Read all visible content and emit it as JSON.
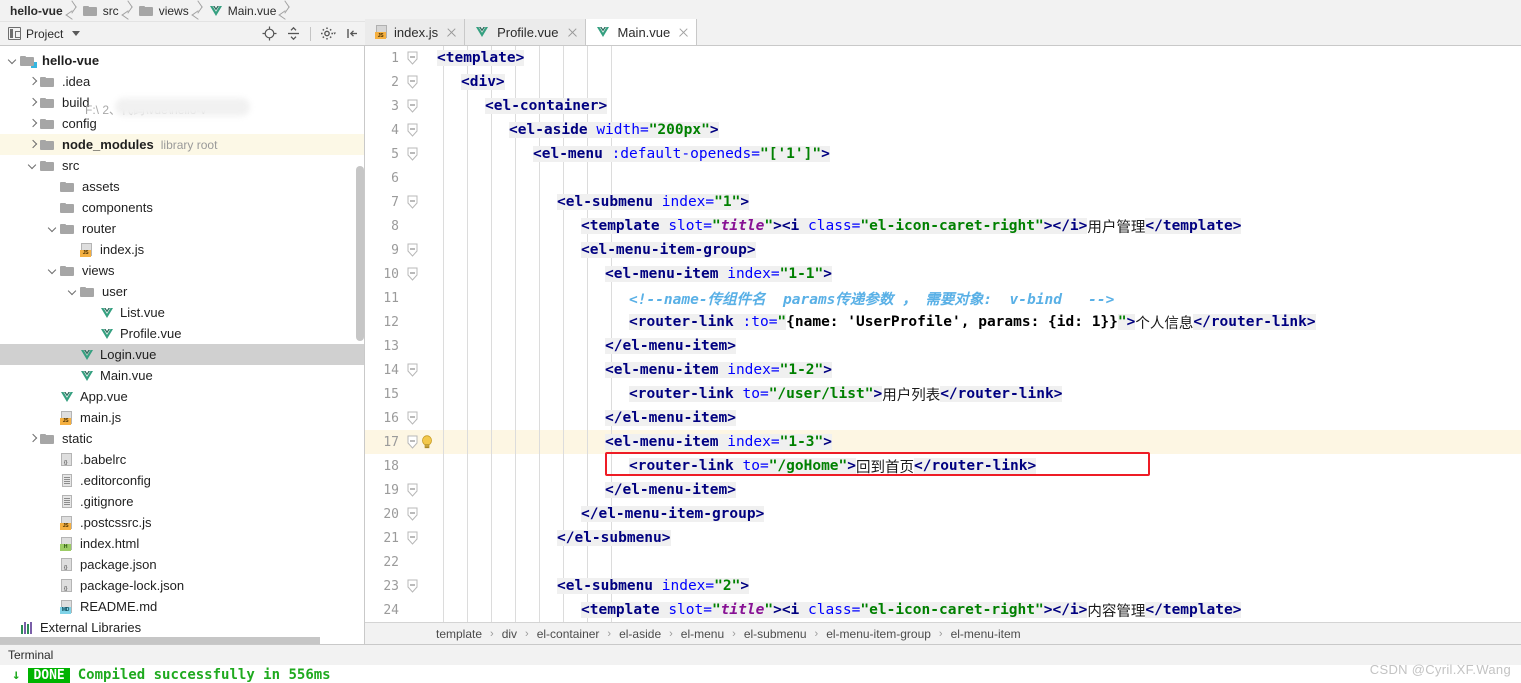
{
  "navbar": {
    "crumbs": [
      {
        "label": "hello-vue",
        "icon": "none",
        "bold": true
      },
      {
        "label": "src",
        "icon": "folder-icon",
        "bold": false
      },
      {
        "label": "views",
        "icon": "folder-icon",
        "bold": false
      },
      {
        "label": "Main.vue",
        "icon": "vue-file-icon",
        "bold": false
      }
    ]
  },
  "toolbar": {
    "project_label": "Project",
    "icons": [
      "locate-target-icon",
      "collapse-all-icon",
      "settings-gear-icon",
      "hide-panel-icon"
    ]
  },
  "tabs": [
    {
      "label": "index.js",
      "icon": "js-file-icon",
      "active": false
    },
    {
      "label": "Profile.vue",
      "icon": "vue-file-icon",
      "active": false
    },
    {
      "label": "Main.vue",
      "icon": "vue-file-icon",
      "active": true
    }
  ],
  "tree": {
    "path_text": "F:\\                                     2、代码\\vue\\hello-v",
    "items": [
      {
        "label": "hello-vue",
        "icon": "module-folder-icon",
        "arrow": "down",
        "indent": 0,
        "bold": true,
        "meta": ""
      },
      {
        "label": ".idea",
        "icon": "folder-icon",
        "arrow": "right",
        "indent": 1,
        "bold": false,
        "meta": ""
      },
      {
        "label": "build",
        "icon": "folder-icon",
        "arrow": "right",
        "indent": 1,
        "bold": false,
        "meta": ""
      },
      {
        "label": "config",
        "icon": "folder-icon",
        "arrow": "right",
        "indent": 1,
        "bold": false,
        "meta": ""
      },
      {
        "label": "node_modules",
        "icon": "folder-icon",
        "arrow": "right",
        "indent": 1,
        "bold": true,
        "meta": "library root",
        "row_style": "library"
      },
      {
        "label": "src",
        "icon": "folder-icon",
        "arrow": "down",
        "indent": 1,
        "bold": false,
        "meta": ""
      },
      {
        "label": "assets",
        "icon": "folder-icon",
        "arrow": "none",
        "indent": 2,
        "bold": false,
        "meta": ""
      },
      {
        "label": "components",
        "icon": "folder-icon",
        "arrow": "none",
        "indent": 2,
        "bold": false,
        "meta": ""
      },
      {
        "label": "router",
        "icon": "folder-icon",
        "arrow": "down",
        "indent": 2,
        "bold": false,
        "meta": ""
      },
      {
        "label": "index.js",
        "icon": "js-file-icon",
        "arrow": "none",
        "indent": 3,
        "bold": false,
        "meta": ""
      },
      {
        "label": "views",
        "icon": "folder-icon",
        "arrow": "down",
        "indent": 2,
        "bold": false,
        "meta": ""
      },
      {
        "label": "user",
        "icon": "folder-icon",
        "arrow": "down",
        "indent": 3,
        "bold": false,
        "meta": ""
      },
      {
        "label": "List.vue",
        "icon": "vue-file-icon",
        "arrow": "none",
        "indent": 4,
        "bold": false,
        "meta": ""
      },
      {
        "label": "Profile.vue",
        "icon": "vue-file-icon",
        "arrow": "none",
        "indent": 4,
        "bold": false,
        "meta": ""
      },
      {
        "label": "Login.vue",
        "icon": "vue-file-icon",
        "arrow": "none",
        "indent": 3,
        "bold": false,
        "meta": "",
        "row_style": "selected"
      },
      {
        "label": "Main.vue",
        "icon": "vue-file-icon",
        "arrow": "none",
        "indent": 3,
        "bold": false,
        "meta": ""
      },
      {
        "label": "App.vue",
        "icon": "vue-file-icon",
        "arrow": "none",
        "indent": 2,
        "bold": false,
        "meta": ""
      },
      {
        "label": "main.js",
        "icon": "js-file-icon",
        "arrow": "none",
        "indent": 2,
        "bold": false,
        "meta": ""
      },
      {
        "label": "static",
        "icon": "folder-icon",
        "arrow": "right",
        "indent": 1,
        "bold": false,
        "meta": ""
      },
      {
        "label": ".babelrc",
        "icon": "json-file-icon",
        "arrow": "none",
        "indent": 2,
        "bold": false,
        "meta": ""
      },
      {
        "label": ".editorconfig",
        "icon": "text-file-icon",
        "arrow": "none",
        "indent": 2,
        "bold": false,
        "meta": ""
      },
      {
        "label": ".gitignore",
        "icon": "text-file-icon",
        "arrow": "none",
        "indent": 2,
        "bold": false,
        "meta": ""
      },
      {
        "label": ".postcssrc.js",
        "icon": "js-file-icon",
        "arrow": "none",
        "indent": 2,
        "bold": false,
        "meta": ""
      },
      {
        "label": "index.html",
        "icon": "html-file-icon",
        "arrow": "none",
        "indent": 2,
        "bold": false,
        "meta": ""
      },
      {
        "label": "package.json",
        "icon": "json-file-icon",
        "arrow": "none",
        "indent": 2,
        "bold": false,
        "meta": ""
      },
      {
        "label": "package-lock.json",
        "icon": "json-file-icon",
        "arrow": "none",
        "indent": 2,
        "bold": false,
        "meta": ""
      },
      {
        "label": "README.md",
        "icon": "md-file-icon",
        "arrow": "none",
        "indent": 2,
        "bold": false,
        "meta": ""
      },
      {
        "label": "External Libraries",
        "icon": "external-lib-icon",
        "arrow": "none",
        "indent": 0,
        "bold": false,
        "meta": ""
      }
    ]
  },
  "editor": {
    "highlight_line": 17,
    "lines": [
      {
        "n": 1,
        "fold": true,
        "indent": 0,
        "tokens": [
          {
            "t": "<template>",
            "c": "tag",
            "hl": true
          }
        ]
      },
      {
        "n": 2,
        "fold": true,
        "indent": 1,
        "tokens": [
          {
            "t": "<div>",
            "c": "tag",
            "hl": true
          }
        ]
      },
      {
        "n": 3,
        "fold": true,
        "indent": 2,
        "tokens": [
          {
            "t": "<el-container>",
            "c": "tag",
            "hl": true
          }
        ]
      },
      {
        "n": 4,
        "fold": true,
        "indent": 3,
        "tokens": [
          {
            "t": "<el-aside ",
            "c": "tag",
            "hl": true
          },
          {
            "t": "width=",
            "c": "attr",
            "hl": true
          },
          {
            "t": "\"200px\"",
            "c": "attrv",
            "hl": true
          },
          {
            "t": ">",
            "c": "tag",
            "hl": true
          }
        ]
      },
      {
        "n": 5,
        "fold": true,
        "indent": 4,
        "tokens": [
          {
            "t": "<el-menu ",
            "c": "tag",
            "hl": true
          },
          {
            "t": ":default-openeds=",
            "c": "attr",
            "hl": true
          },
          {
            "t": "\"['1']\"",
            "c": "attrv",
            "hl": true
          },
          {
            "t": ">",
            "c": "tag",
            "hl": true
          }
        ]
      },
      {
        "n": 6,
        "fold": false,
        "indent": 5,
        "tokens": []
      },
      {
        "n": 7,
        "fold": true,
        "indent": 5,
        "tokens": [
          {
            "t": "<el-submenu ",
            "c": "tag",
            "hl": true
          },
          {
            "t": "index=",
            "c": "attr",
            "hl": true
          },
          {
            "t": "\"1\"",
            "c": "attrv",
            "hl": true
          },
          {
            "t": ">",
            "c": "tag",
            "hl": true
          }
        ]
      },
      {
        "n": 8,
        "fold": false,
        "indent": 6,
        "tokens": [
          {
            "t": "<template ",
            "c": "tag",
            "hl": true
          },
          {
            "t": "slot=",
            "c": "attr",
            "hl": true
          },
          {
            "t": "\"",
            "c": "attrv",
            "hl": true
          },
          {
            "t": "title",
            "c": "attrvi",
            "hl": true
          },
          {
            "t": "\"",
            "c": "attrv",
            "hl": true
          },
          {
            "t": "><i ",
            "c": "tag",
            "hl": true
          },
          {
            "t": "class=",
            "c": "attr",
            "hl": true
          },
          {
            "t": "\"el-icon-caret-right\"",
            "c": "attrv",
            "hl": true
          },
          {
            "t": "></i>",
            "c": "tag",
            "hl": true
          },
          {
            "t": "用户管理",
            "c": "txt",
            "hl": false
          },
          {
            "t": "</template>",
            "c": "tag",
            "hl": true
          }
        ]
      },
      {
        "n": 9,
        "fold": true,
        "indent": 6,
        "tokens": [
          {
            "t": "<el-menu-item-group>",
            "c": "tag",
            "hl": true
          }
        ]
      },
      {
        "n": 10,
        "fold": true,
        "indent": 7,
        "tokens": [
          {
            "t": "<el-menu-item ",
            "c": "tag",
            "hl": true
          },
          {
            "t": "index=",
            "c": "attr",
            "hl": true
          },
          {
            "t": "\"1-1\"",
            "c": "attrv",
            "hl": true
          },
          {
            "t": ">",
            "c": "tag",
            "hl": true
          }
        ]
      },
      {
        "n": 11,
        "fold": false,
        "indent": 8,
        "tokens": [
          {
            "t": "<!--name-传组件名  params传递参数 ， 需要对象:  v-bind   -->",
            "c": "cmt",
            "hl": false
          }
        ]
      },
      {
        "n": 12,
        "fold": false,
        "indent": 8,
        "tokens": [
          {
            "t": "<router-link ",
            "c": "tag",
            "hl": true
          },
          {
            "t": ":to=",
            "c": "attr",
            "hl": true
          },
          {
            "t": "\"",
            "c": "attrv",
            "hl": true
          },
          {
            "t": "{name: 'UserProfile', params: {id: 1}}",
            "c": "jsv",
            "hl": false
          },
          {
            "t": "\"",
            "c": "attrv",
            "hl": true
          },
          {
            "t": ">",
            "c": "tag",
            "hl": true
          },
          {
            "t": "个人信息",
            "c": "txt",
            "hl": false
          },
          {
            "t": "</router-link>",
            "c": "tag",
            "hl": true
          }
        ]
      },
      {
        "n": 13,
        "fold": false,
        "indent": 7,
        "tokens": [
          {
            "t": "</el-menu-item>",
            "c": "tag",
            "hl": true
          }
        ]
      },
      {
        "n": 14,
        "fold": true,
        "indent": 7,
        "tokens": [
          {
            "t": "<el-menu-item ",
            "c": "tag",
            "hl": true
          },
          {
            "t": "index=",
            "c": "attr",
            "hl": true
          },
          {
            "t": "\"1-2\"",
            "c": "attrv",
            "hl": true
          },
          {
            "t": ">",
            "c": "tag",
            "hl": true
          }
        ]
      },
      {
        "n": 15,
        "fold": false,
        "indent": 8,
        "tokens": [
          {
            "t": "<router-link ",
            "c": "tag",
            "hl": true
          },
          {
            "t": "to=",
            "c": "attr",
            "hl": true
          },
          {
            "t": "\"/user/list\"",
            "c": "attrv",
            "hl": true
          },
          {
            "t": ">",
            "c": "tag",
            "hl": true
          },
          {
            "t": "用户列表",
            "c": "txt",
            "hl": false
          },
          {
            "t": "</router-link>",
            "c": "tag",
            "hl": true
          }
        ]
      },
      {
        "n": 16,
        "fold": true,
        "indent": 7,
        "tokens": [
          {
            "t": "</el-menu-item>",
            "c": "tag",
            "hl": true
          }
        ]
      },
      {
        "n": 17,
        "fold": true,
        "indent": 7,
        "tokens": [
          {
            "t": "<el-menu-item ",
            "c": "tag",
            "hl": true
          },
          {
            "t": "index=",
            "c": "attr",
            "hl": true
          },
          {
            "t": "\"1-3\"",
            "c": "attrv",
            "hl": true
          },
          {
            "t": ">",
            "c": "tag",
            "hl": true
          }
        ]
      },
      {
        "n": 18,
        "fold": false,
        "indent": 8,
        "tokens": [
          {
            "t": "<router-link ",
            "c": "tag",
            "hl": true
          },
          {
            "t": "to=",
            "c": "attr",
            "hl": true
          },
          {
            "t": "\"/goHome\"",
            "c": "attrv",
            "hl": true
          },
          {
            "t": ">",
            "c": "tag",
            "hl": true
          },
          {
            "t": "回到首页",
            "c": "txt",
            "hl": false
          },
          {
            "t": "</router-link>",
            "c": "tag",
            "hl": true
          }
        ]
      },
      {
        "n": 19,
        "fold": true,
        "indent": 7,
        "tokens": [
          {
            "t": "</el-menu-item>",
            "c": "tag",
            "hl": true
          }
        ]
      },
      {
        "n": 20,
        "fold": true,
        "indent": 6,
        "tokens": [
          {
            "t": "</el-menu-item-group>",
            "c": "tag",
            "hl": true
          }
        ]
      },
      {
        "n": 21,
        "fold": true,
        "indent": 5,
        "tokens": [
          {
            "t": "</el-submenu>",
            "c": "tag",
            "hl": true
          }
        ]
      },
      {
        "n": 22,
        "fold": false,
        "indent": 5,
        "tokens": []
      },
      {
        "n": 23,
        "fold": true,
        "indent": 5,
        "tokens": [
          {
            "t": "<el-submenu ",
            "c": "tag",
            "hl": true
          },
          {
            "t": "index=",
            "c": "attr",
            "hl": true
          },
          {
            "t": "\"2\"",
            "c": "attrv",
            "hl": true
          },
          {
            "t": ">",
            "c": "tag",
            "hl": true
          }
        ]
      },
      {
        "n": 24,
        "fold": false,
        "indent": 6,
        "tokens": [
          {
            "t": "<template ",
            "c": "tag",
            "hl": true
          },
          {
            "t": "slot=",
            "c": "attr",
            "hl": true
          },
          {
            "t": "\"",
            "c": "attrv",
            "hl": true
          },
          {
            "t": "title",
            "c": "attrvi",
            "hl": true
          },
          {
            "t": "\"",
            "c": "attrv",
            "hl": true
          },
          {
            "t": "><i ",
            "c": "tag",
            "hl": true
          },
          {
            "t": "class=",
            "c": "attr",
            "hl": true
          },
          {
            "t": "\"el-icon-caret-right\"",
            "c": "attrv",
            "hl": true
          },
          {
            "t": "></i>",
            "c": "tag",
            "hl": true
          },
          {
            "t": "内容管理",
            "c": "txt",
            "hl": false
          },
          {
            "t": "</template>",
            "c": "tag",
            "hl": true
          }
        ]
      }
    ],
    "breadcrumb": [
      "template",
      "div",
      "el-container",
      "el-aside",
      "el-menu",
      "el-submenu",
      "el-menu-item-group",
      "el-menu-item"
    ]
  },
  "terminal": {
    "title": "Terminal",
    "badge": "DONE",
    "message": "Compiled successfully in 556ms"
  },
  "watermark": "CSDN @Cyril.XF.Wang",
  "colors": {
    "accent_red": "#ee1c25",
    "tag": "#000080",
    "attr": "#0000ff",
    "attr_value": "#008000",
    "comment": "#59b0e6",
    "done_green": "#00b300",
    "selection": "#d0d0d0",
    "library_row": "#fcf8e6",
    "current_line": "#fdf6e3"
  }
}
